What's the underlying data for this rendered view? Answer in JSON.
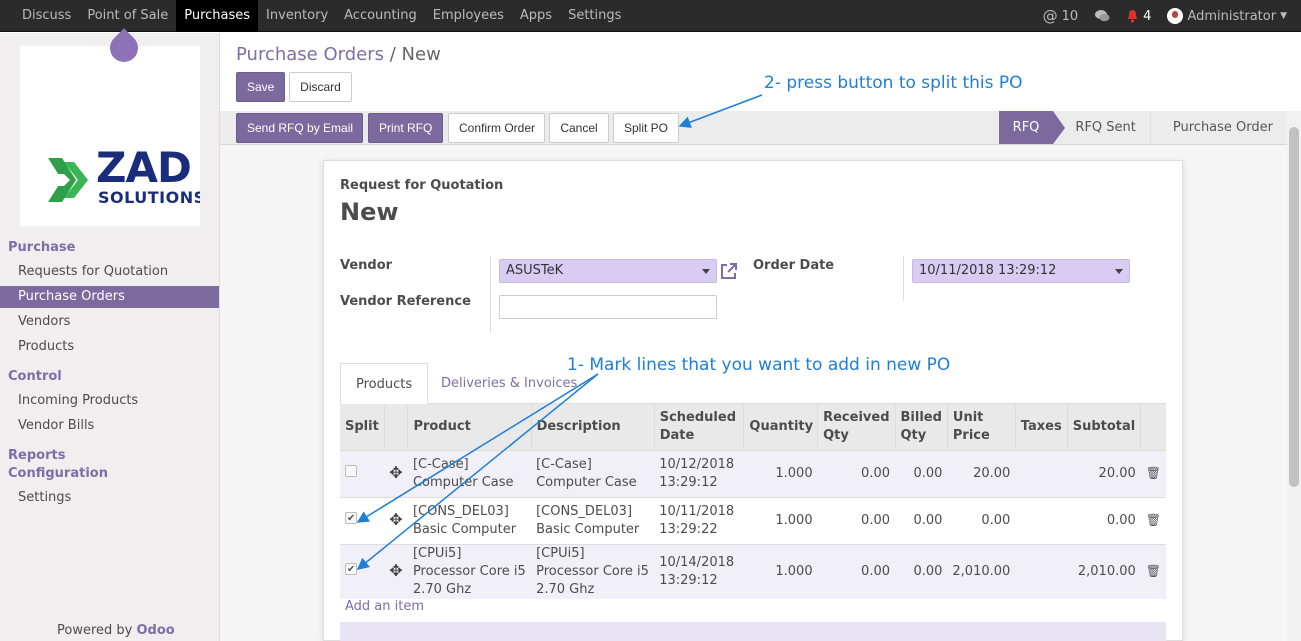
{
  "topmenu": [
    "Discuss",
    "Point of Sale",
    "Purchases",
    "Inventory",
    "Accounting",
    "Employees",
    "Apps",
    "Settings"
  ],
  "topright": {
    "mentions": "10",
    "notifications": "4",
    "user": "Administrator"
  },
  "sidebar": {
    "sections": [
      "Purchase",
      "Control",
      "Reports",
      "Configuration"
    ],
    "purchase_items": [
      "Requests for Quotation",
      "Purchase Orders",
      "Vendors",
      "Products"
    ],
    "control_items": [
      "Incoming Products",
      "Vendor Bills"
    ],
    "config_items": [
      "Settings"
    ],
    "powered_by": "Powered by",
    "powered_brand": "Odoo",
    "logo_main": "ZAD",
    "logo_sub": "SOLUTIONS"
  },
  "breadcrumb": {
    "parent": "Purchase Orders",
    "sep": "/",
    "current": "New"
  },
  "buttons": {
    "save": "Save",
    "discard": "Discard",
    "send_rfq": "Send RFQ by Email",
    "print_rfq": "Print RFQ",
    "confirm": "Confirm Order",
    "cancel": "Cancel",
    "split": "Split PO"
  },
  "stages": [
    "RFQ",
    "RFQ Sent",
    "Purchase Order"
  ],
  "form": {
    "title_small": "Request for Quotation",
    "name": "New",
    "vendor_label": "Vendor",
    "vendor_value": "ASUSTeK",
    "vendor_ref_label": "Vendor Reference",
    "order_date_label": "Order Date",
    "order_date_value": "10/11/2018 13:29:12"
  },
  "tabs": [
    "Products",
    "Deliveries & Invoices"
  ],
  "table": {
    "headers": [
      "Split",
      "",
      "Product",
      "Description",
      "Scheduled Date",
      "Quantity",
      "Received Qty",
      "Billed Qty",
      "Unit Price",
      "Taxes",
      "Subtotal",
      ""
    ],
    "rows": [
      {
        "checked": false,
        "product": "[C-Case] Computer Case",
        "description": "[C-Case] Computer Case",
        "date": "10/12/2018 13:29:12",
        "qty": "1.000",
        "received": "0.00",
        "billed": "0.00",
        "price": "20.00",
        "taxes": "",
        "subtotal": "20.00"
      },
      {
        "checked": true,
        "product": "[CONS_DEL03] Basic Computer",
        "description": "[CONS_DEL03] Basic Computer",
        "date": "10/11/2018 13:29:22",
        "qty": "1.000",
        "received": "0.00",
        "billed": "0.00",
        "price": "0.00",
        "taxes": "",
        "subtotal": "0.00"
      },
      {
        "checked": true,
        "product": "[CPUi5] Processor Core i5 2.70 Ghz",
        "description": "[CPUi5] Processor Core i5 2.70 Ghz",
        "date": "10/14/2018 13:29:12",
        "qty": "1.000",
        "received": "0.00",
        "billed": "0.00",
        "price": "2,010.00",
        "taxes": "",
        "subtotal": "2,010.00"
      }
    ],
    "add_item": "Add an item"
  },
  "annotations": {
    "a1": "1- Mark lines that you want to add in new PO",
    "a2": "2- press button to split this PO"
  },
  "colors": {
    "brand": "#7c6a9f",
    "annotation": "#1e7fd6",
    "topbar": "#2b2b2b"
  }
}
